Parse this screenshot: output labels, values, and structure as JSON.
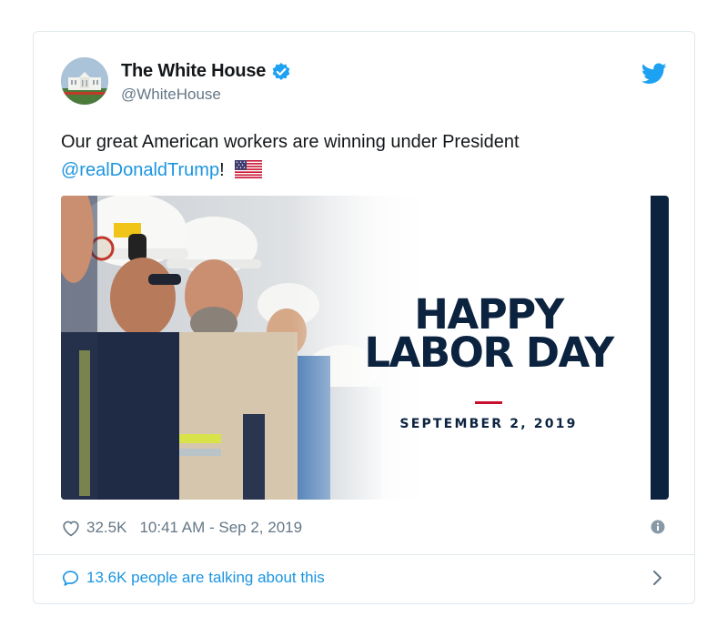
{
  "author": {
    "display_name": "The White House",
    "handle": "@WhiteHouse",
    "verified_icon": "verified-badge-icon",
    "avatar": "white-house-building-avatar"
  },
  "brand_icon": "twitter-bird-icon",
  "tweet": {
    "text_before": "Our great American workers are winning under President",
    "mention": "@realDonaldTrump",
    "text_after": "!",
    "emoji": "us-flag-emoji"
  },
  "media": {
    "headline_line1": "HAPPY",
    "headline_line2": "LABOR DAY",
    "date": "SEPTEMBER 2, 2019"
  },
  "stats": {
    "likes": "32.5K",
    "timestamp": "10:41 AM - Sep 2, 2019"
  },
  "footer": {
    "talking": "13.6K people are talking about this"
  },
  "colors": {
    "accent_blue": "#1da1f2",
    "link_blue": "#1b95e0",
    "navy": "#0c2340",
    "red": "#c8102e",
    "muted_text": "#657786",
    "border": "#e1e8ed"
  }
}
